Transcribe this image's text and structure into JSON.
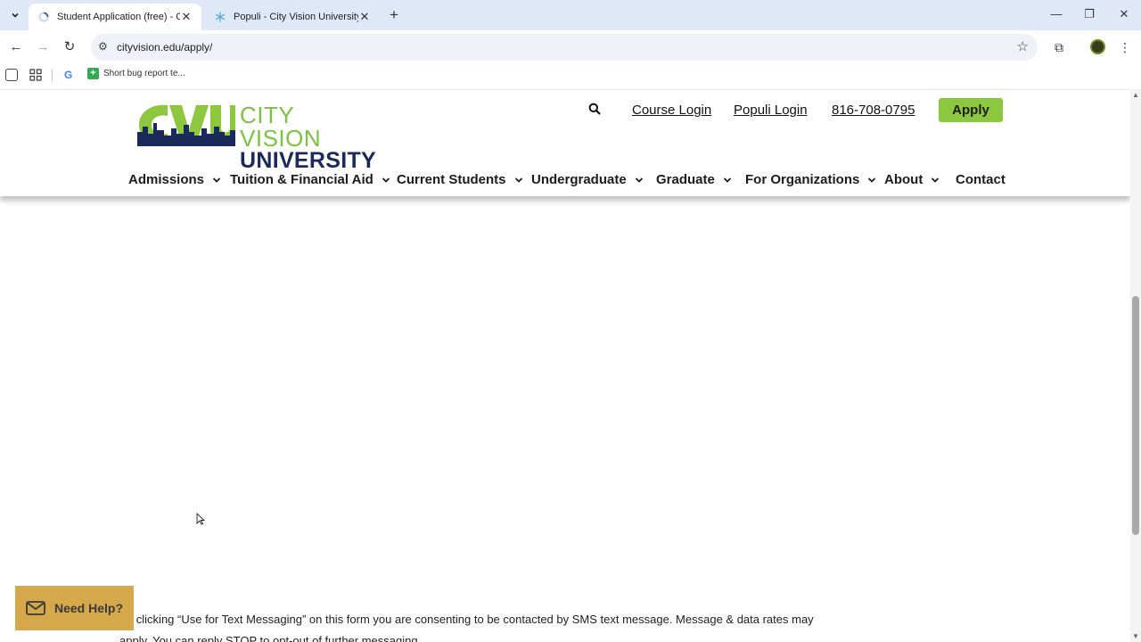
{
  "browser": {
    "tabs": [
      {
        "title": "Student Application (free) - City",
        "active": true,
        "icon": "loading-spinner-icon"
      },
      {
        "title": "Populi - City Vision University",
        "active": false,
        "icon": "snowflake-icon"
      }
    ],
    "url": "cityvision.edu/apply/",
    "bookmarks": [
      {
        "label": "Short bug report te...",
        "icon": "green-plus-icon"
      }
    ]
  },
  "site": {
    "logo": {
      "line1": "CITY VISION",
      "line2": "UNIVERSITY",
      "mark": "CVU"
    },
    "utility": {
      "course_login": "Course Login",
      "populi_login": "Populi Login",
      "phone": "816-708-0795",
      "apply": "Apply"
    },
    "nav": [
      {
        "label": "Admissions",
        "dropdown": true
      },
      {
        "label": "Tuition & Financial Aid",
        "dropdown": true
      },
      {
        "label": "Current Students",
        "dropdown": true
      },
      {
        "label": "Undergraduate",
        "dropdown": true
      },
      {
        "label": "Graduate",
        "dropdown": true
      },
      {
        "label": "For Organizations",
        "dropdown": true
      },
      {
        "label": "About",
        "dropdown": true
      },
      {
        "label": "Contact",
        "dropdown": false
      }
    ],
    "colors": {
      "brand_green": "#8dc63f",
      "brand_navy": "#1c2a5b",
      "help_gold": "#d4a84b"
    }
  },
  "content": {
    "consent_text": "By clicking “Use for Text Messaging” on this form you are consenting to be contacted by SMS text message. Message & data rates may apply. You can reply STOP to opt-out of further messaging."
  },
  "help_widget": {
    "label": "Need Help?"
  }
}
